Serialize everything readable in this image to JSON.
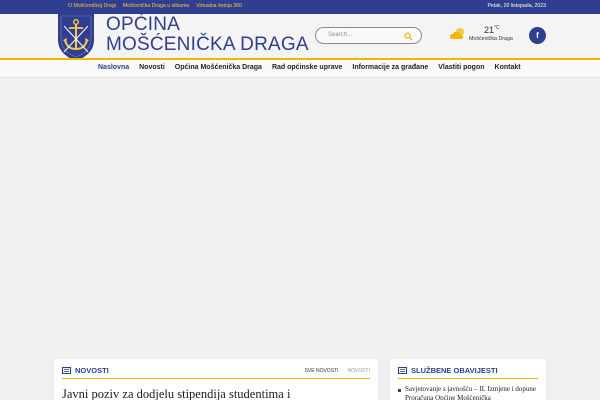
{
  "topbar": {
    "links": [
      "O Mošćeničkoj Dragi",
      "Mošćenička Draga u slikama",
      "Virtualna šetnja 360"
    ],
    "date": "Petak, 20 listopada, 2023"
  },
  "header": {
    "brand_line1": "OPĆINA",
    "brand_line2": "MOŠĆENIČKA DRAGA",
    "search_placeholder": "Search...",
    "weather": {
      "temp": "21",
      "unit": "°C",
      "location": "Mošćenička Draga",
      "icon": "partly-cloudy-icon"
    },
    "social": {
      "facebook_label": "f"
    }
  },
  "nav": {
    "items": [
      "Naslovna",
      "Novosti",
      "Općina Mošćenička Draga",
      "Rad općinske uprave",
      "Informacije za građane",
      "Vlastiti pogon",
      "Kontakt"
    ],
    "active": "Naslovna"
  },
  "news": {
    "title": "NOVOSTI",
    "tab_all": "SVE NOVOSTI",
    "tab_news": "NOVOSTI",
    "headline": "Javni poziv za dodjelu stipendija studentima i"
  },
  "notices": {
    "title": "SLUŽBENE OBAVIJESTI",
    "item1": "Savjetovanje s javnošću – II. Izmjene i dopune Proračuna Općine Mošćenička"
  },
  "colors": {
    "brand": "#2f3e8e",
    "accent": "#f2b705",
    "link_gold": "#f2c94c"
  }
}
